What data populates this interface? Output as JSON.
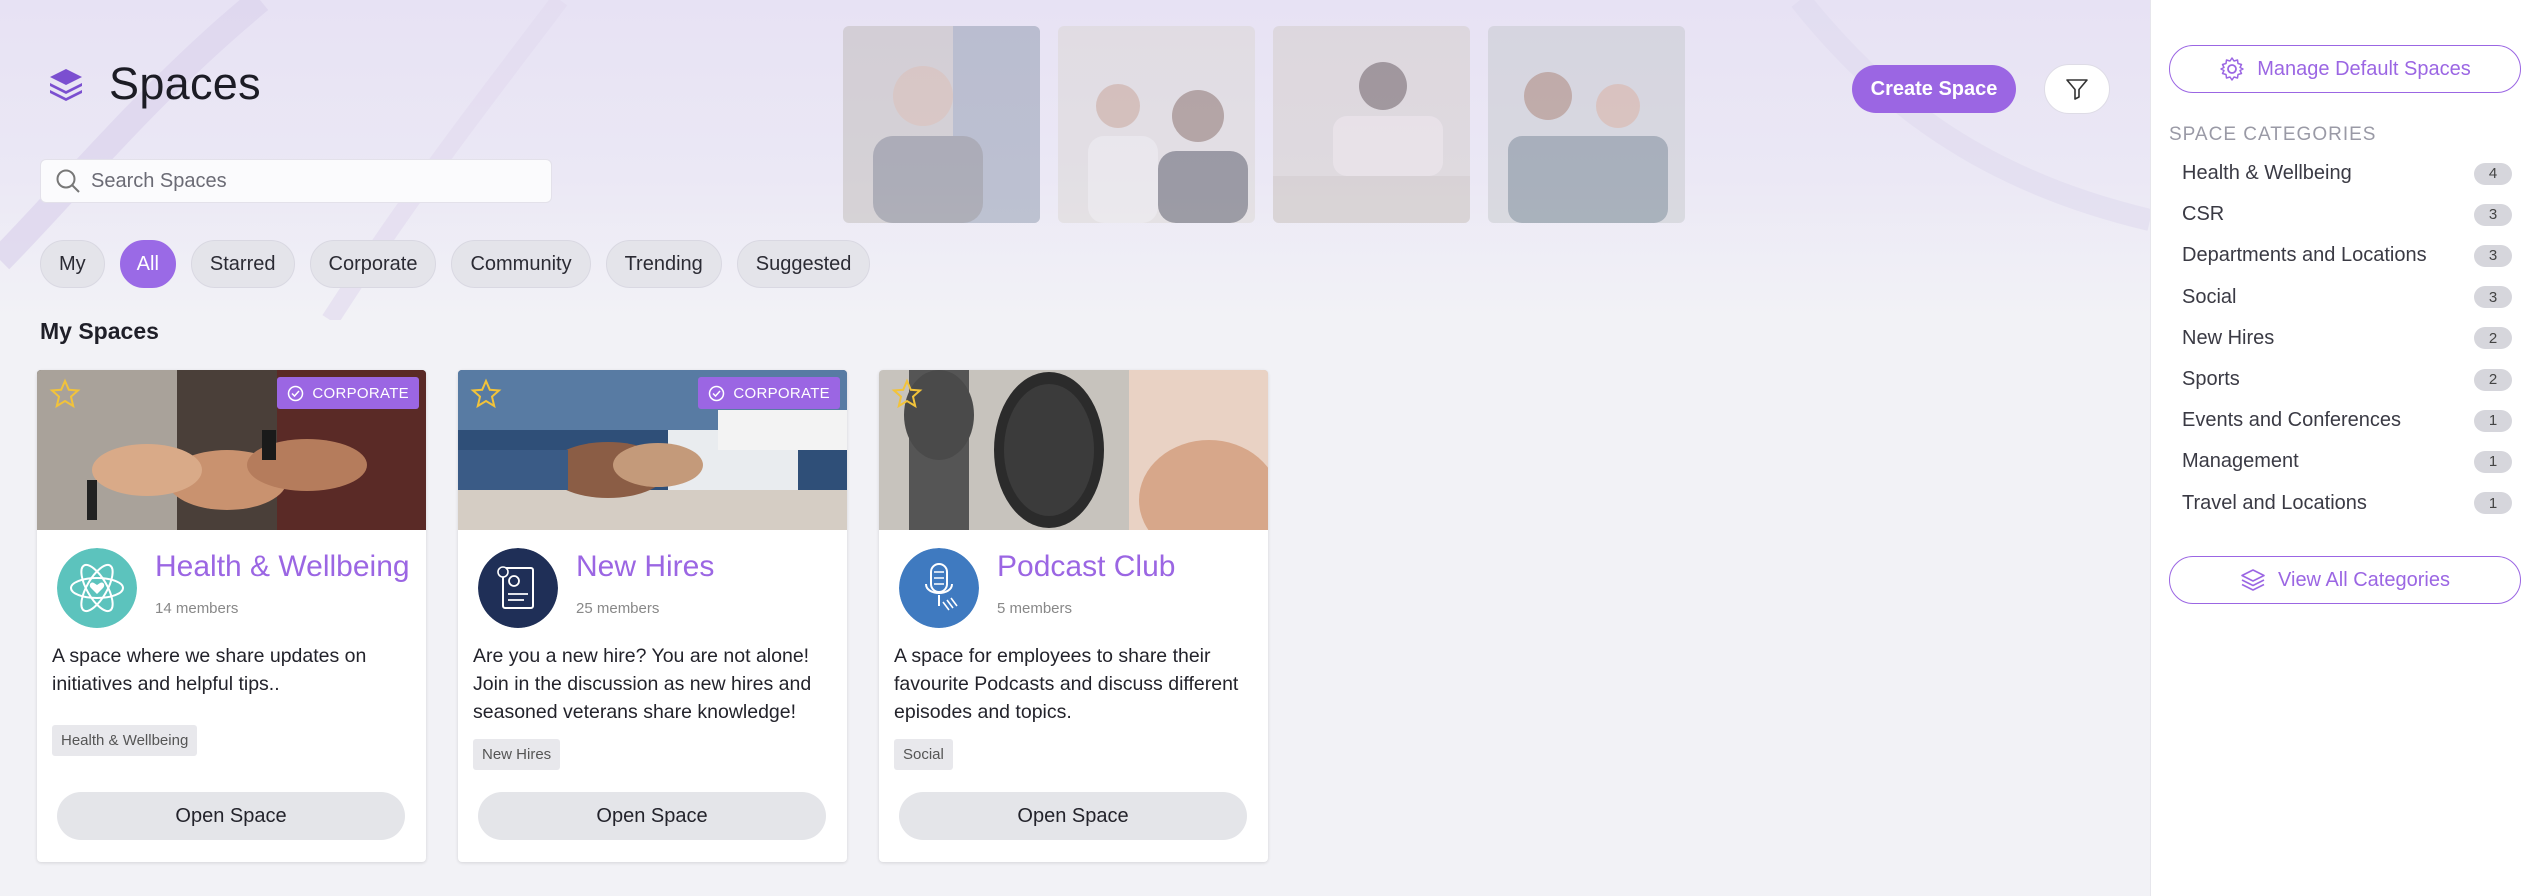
{
  "page": {
    "title": "Spaces"
  },
  "search": {
    "placeholder": "Search Spaces"
  },
  "filters": [
    {
      "label": "My",
      "active": false
    },
    {
      "label": "All",
      "active": true
    },
    {
      "label": "Starred",
      "active": false
    },
    {
      "label": "Corporate",
      "active": false
    },
    {
      "label": "Community",
      "active": false
    },
    {
      "label": "Trending",
      "active": false
    },
    {
      "label": "Suggested",
      "active": false
    }
  ],
  "header": {
    "create_label": "Create Space"
  },
  "section": {
    "title": "My Spaces"
  },
  "cards": [
    {
      "name": "Health & Wellbeing",
      "members": "14 members",
      "badge": "CORPORATE",
      "description": "A space where we share updates on initiatives and helpful tips..",
      "tag": "Health & Wellbeing",
      "open_label": "Open Space"
    },
    {
      "name": "New Hires",
      "members": "25 members",
      "badge": "CORPORATE",
      "description": "Are you a new hire? You are not alone! Join in the discussion as new hires and seasoned veterans share knowledge!",
      "tag": "New Hires",
      "open_label": "Open Space"
    },
    {
      "name": "Podcast Club",
      "members": "5 members",
      "badge": "",
      "description": "A space for employees to share their favourite Podcasts and discuss different episodes and topics.",
      "tag": "Social",
      "open_label": "Open Space"
    }
  ],
  "sidebar": {
    "manage_label": "Manage Default Spaces",
    "categories_title": "SPACE CATEGORIES",
    "categories": [
      {
        "label": "Health & Wellbeing",
        "count": "4"
      },
      {
        "label": "CSR",
        "count": "3"
      },
      {
        "label": "Departments and Locations",
        "count": "3"
      },
      {
        "label": "Social",
        "count": "3"
      },
      {
        "label": "New Hires",
        "count": "2"
      },
      {
        "label": "Sports",
        "count": "2"
      },
      {
        "label": "Events and Conferences",
        "count": "1"
      },
      {
        "label": "Management",
        "count": "1"
      },
      {
        "label": "Travel and Locations",
        "count": "1"
      }
    ],
    "view_all_label": "View All Categories"
  },
  "colors": {
    "accent": "#9b66e3",
    "card_bg": "#ffffff",
    "page_bg": "#f2f2f6"
  }
}
